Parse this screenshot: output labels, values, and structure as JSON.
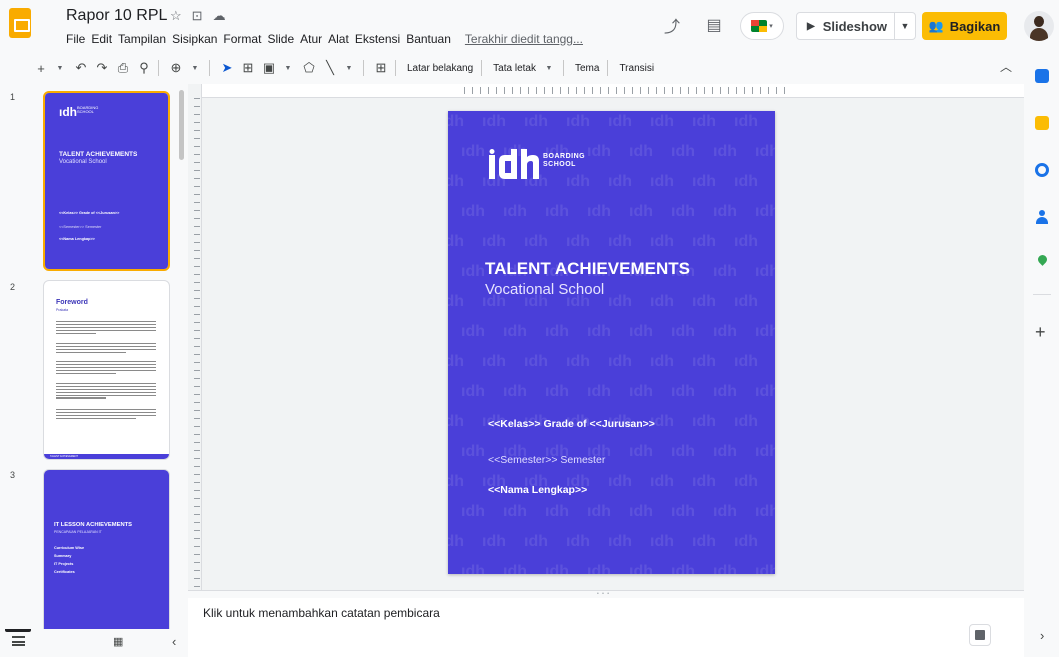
{
  "header": {
    "doc_title": "Rapor 10 RPL",
    "menu": [
      "File",
      "Edit",
      "Tampilan",
      "Sisipkan",
      "Format",
      "Slide",
      "Atur",
      "Alat",
      "Ekstensi",
      "Bantuan"
    ],
    "last_edit": "Terakhir diedit tangg...",
    "slideshow_label": "Slideshow",
    "share_label": "Bagikan"
  },
  "toolbar": {
    "background_label": "Latar belakang",
    "layout_label": "Tata letak",
    "theme_label": "Tema",
    "transition_label": "Transisi"
  },
  "filmstrip": {
    "slides": [
      {
        "number": "1",
        "logo": "ıdh",
        "logo_sub": "BOARDING SCHOOL",
        "title": "TALENT ACHIEVEMENTS",
        "subtitle": "Vocational School",
        "line1": "<<Kelas>> Grade of <<Jurusan>>",
        "line2": "<<Semester>> Semester",
        "line3": "<<Nama Lengkap>>"
      },
      {
        "number": "2",
        "title": "Foreword",
        "subtitle": "Prakata",
        "footer": "TALENT ACHIEVEMENT"
      },
      {
        "number": "3",
        "title": "IT LESSON ACHIEVEMENTS",
        "subtitle": "PENCAPAIAN PELAJARAN IT",
        "items": [
          "Curriculum Wise",
          "Summary",
          "IT Projects",
          "Certificates"
        ]
      }
    ]
  },
  "slide": {
    "logo_text_line1": "BOARDING",
    "logo_text_line2": "SCHOOL",
    "title": "TALENT ACHIEVEMENTS",
    "subtitle": "Vocational School",
    "line1": "<<Kelas>> Grade of <<Jurusan>>",
    "line2": "<<Semester>> Semester",
    "line3": "<<Nama Lengkap>>",
    "pattern_glyph": "ıdh",
    "background_color": "#4a3fd9"
  },
  "notes": {
    "placeholder": "Klik untuk menambahkan catatan pembicara"
  },
  "colors": {
    "accent": "#f9ab00",
    "share": "#fbbc04",
    "slide_bg": "#4a3fd9"
  }
}
